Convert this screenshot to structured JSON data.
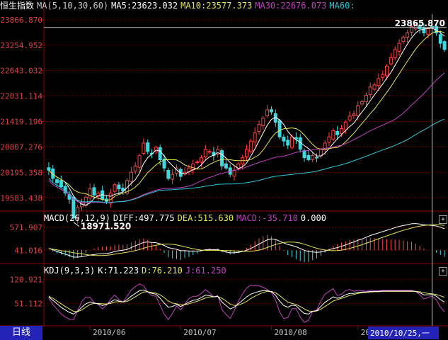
{
  "index_name": "恒生指数",
  "period_tab": "日线",
  "main_header": {
    "ma_label": "MA(5,10,30,60)",
    "ma5": "MA5:23623.032",
    "ma10": "MA10:23577.373",
    "ma30": "MA30:22676.073",
    "ma60": "MA60:"
  },
  "macd_header": {
    "label": "MACD(26,12,9)",
    "diff": "DIFF:497.775",
    "dea": "DEA:515.630",
    "macd": "MACD:-35.710",
    "zero": "0.000"
  },
  "kdj_header": {
    "label": "KDJ(9,3,3)",
    "k": "K:71.223",
    "d": "D:76.210",
    "j": "J:61.250"
  },
  "colors": {
    "up": "#ff4040",
    "down": "#3ed8e0",
    "ma5": "#ffffff",
    "ma10": "#e5e552",
    "ma30": "#c040c0",
    "ma60": "#28c8d8",
    "grid": "#8b0000",
    "axis_text": "#e04040",
    "hist_up": "#ff5050",
    "hist_down": "#3ed8e0",
    "date_cursor_bg": "#2323b8"
  },
  "chart_data": [
    {
      "type": "candlestick",
      "title": "恒生指数",
      "y_ticks": [
        "23866.870",
        "23254.952",
        "22643.032",
        "22031.114",
        "21419.196",
        "20807.276",
        "20195.358",
        "19583.438"
      ],
      "ylim": [
        19300,
        24000
      ],
      "annotations": [
        {
          "label": "18971.520",
          "kind": "low"
        },
        {
          "label": "23865.870",
          "kind": "high"
        }
      ],
      "x_month_labels": [
        "2010/06",
        "2010/07",
        "2010/08",
        "2010/09"
      ],
      "cursor_date": "2010/10/25,一",
      "close": [
        20250,
        20050,
        19950,
        19850,
        19700,
        19550,
        19100,
        19350,
        19450,
        19600,
        19800,
        19650,
        19700,
        19550,
        19500,
        19700,
        19900,
        19800,
        19750,
        20000,
        20200,
        20350,
        20600,
        20900,
        20700,
        20650,
        20800,
        20500,
        20300,
        20050,
        20150,
        20300,
        20100,
        20200,
        20300,
        20400,
        20450,
        20550,
        20750,
        20700,
        20600,
        20750,
        20350,
        20300,
        20150,
        20250,
        20400,
        20550,
        20750,
        20950,
        21150,
        21350,
        21500,
        21700,
        21650,
        21400,
        21050,
        20950,
        20850,
        21050,
        21000,
        20750,
        20550,
        20500,
        20600,
        20550,
        20750,
        20900,
        21050,
        21200,
        21100,
        21250,
        21400,
        21550,
        21600,
        21800,
        21900,
        22050,
        22250,
        22300,
        22450,
        22550,
        22750,
        22950,
        23150,
        23300,
        23450,
        23550,
        23700,
        23750,
        23650,
        23550,
        23650,
        23700,
        23550,
        23300,
        23150
      ]
    },
    {
      "type": "macd",
      "y_ticks": [
        "571.907",
        "41.016"
      ],
      "ylim": [
        -200,
        650
      ],
      "diff": [
        40,
        10,
        -30,
        -60,
        -90,
        -120,
        -160,
        -160,
        -150,
        -130,
        -110,
        -100,
        -85,
        -80,
        -75,
        -60,
        -30,
        -10,
        0,
        20,
        60,
        100,
        140,
        180,
        190,
        180,
        175,
        150,
        110,
        60,
        40,
        20,
        -10,
        -10,
        -20,
        -20,
        -20,
        -10,
        10,
        15,
        10,
        15,
        -20,
        -40,
        -60,
        -60,
        -50,
        -30,
        0,
        40,
        90,
        140,
        190,
        240,
        260,
        250,
        210,
        170,
        130,
        110,
        80,
        40,
        0,
        -30,
        -40,
        -50,
        -40,
        -20,
        10,
        40,
        60,
        90,
        120,
        160,
        190,
        230,
        260,
        300,
        340,
        370,
        400,
        430,
        460,
        490,
        520,
        550,
        570,
        590,
        610,
        615,
        605,
        590,
        580,
        570,
        560,
        530,
        497
      ]
    },
    {
      "type": "kdj",
      "y_ticks": [
        "120.921",
        "51.112"
      ],
      "ylim": [
        -10,
        130
      ],
      "k": [
        70,
        60,
        50,
        40,
        32,
        25,
        20,
        28,
        40,
        50,
        55,
        52,
        50,
        45,
        48,
        55,
        62,
        58,
        55,
        62,
        72,
        80,
        88,
        90,
        85,
        80,
        78,
        66,
        52,
        40,
        42,
        48,
        42,
        48,
        55,
        60,
        62,
        68,
        75,
        74,
        70,
        72,
        55,
        45,
        35,
        40,
        50,
        60,
        70,
        78,
        82,
        86,
        88,
        88,
        85,
        75,
        58,
        45,
        40,
        46,
        44,
        32,
        22,
        20,
        28,
        30,
        42,
        54,
        62,
        70,
        66,
        70,
        76,
        80,
        80,
        83,
        84,
        84,
        86,
        86,
        86,
        87,
        87,
        87,
        87,
        87,
        87,
        87,
        87,
        86,
        82,
        76,
        76,
        77,
        72,
        62,
        55
      ],
      "d": [
        72,
        66,
        58,
        50,
        42,
        35,
        28,
        27,
        32,
        40,
        48,
        51,
        51,
        50,
        49,
        51,
        55,
        56,
        55,
        57,
        63,
        70,
        78,
        84,
        85,
        83,
        81,
        76,
        68,
        58,
        52,
        50,
        47,
        47,
        50,
        54,
        57,
        62,
        67,
        70,
        70,
        71,
        66,
        58,
        49,
        45,
        46,
        51,
        57,
        65,
        72,
        78,
        83,
        86,
        86,
        82,
        74,
        64,
        55,
        51,
        48,
        42,
        35,
        29,
        28,
        29,
        34,
        42,
        50,
        58,
        62,
        66,
        70,
        74,
        77,
        80,
        82,
        83,
        84,
        85,
        85,
        86,
        86,
        86,
        86,
        86,
        86,
        86,
        86,
        86,
        85,
        82,
        80,
        79,
        77,
        73,
        69
      ]
    }
  ]
}
